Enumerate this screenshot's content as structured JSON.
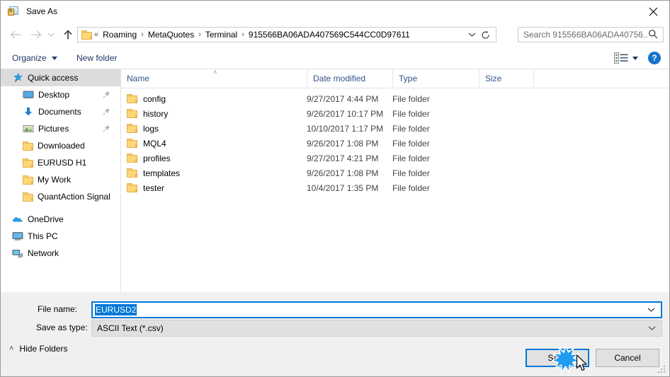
{
  "window": {
    "title": "Save As",
    "title_icon": "save-as-picture-icon",
    "close_label": "✕"
  },
  "nav": {
    "back_icon": "arrow-left-icon",
    "forward_icon": "arrow-right-icon",
    "recent_icon": "chevron-down-icon",
    "up_icon": "arrow-up-icon",
    "breadcrumb_prefix": "«",
    "breadcrumbs": [
      "Roaming",
      "MetaQuotes",
      "Terminal",
      "915566BA06ADA407569C544CC0D97611"
    ],
    "breadcrumb_separator": "›",
    "dropdown_icon": "chevron-down-icon",
    "refresh_icon": "refresh-icon"
  },
  "search": {
    "placeholder": "Search 915566BA06ADA40756...",
    "icon": "search-icon"
  },
  "toolbar": {
    "organize_label": "Organize",
    "new_folder_label": "New folder",
    "view_icon": "view-layout-icon",
    "view_caret_icon": "caret-down-icon",
    "help_label": "?"
  },
  "sidebar": {
    "items": [
      {
        "label": "Quick access",
        "icon": "star-pin-icon",
        "level": 0,
        "selected": true,
        "pinned": false
      },
      {
        "label": "Desktop",
        "icon": "monitor-icon",
        "level": 1,
        "selected": false,
        "pinned": true
      },
      {
        "label": "Documents",
        "icon": "download-arrow-icon",
        "level": 1,
        "selected": false,
        "pinned": true
      },
      {
        "label": "Pictures",
        "icon": "picture-icon",
        "level": 1,
        "selected": false,
        "pinned": true
      },
      {
        "label": "Downloaded",
        "icon": "folder-icon",
        "level": 1,
        "selected": false,
        "pinned": false
      },
      {
        "label": "EURUSD H1",
        "icon": "folder-icon",
        "level": 1,
        "selected": false,
        "pinned": false
      },
      {
        "label": "My Work",
        "icon": "folder-icon",
        "level": 1,
        "selected": false,
        "pinned": false
      },
      {
        "label": "QuantAction Signal",
        "icon": "folder-icon",
        "level": 1,
        "selected": false,
        "pinned": false
      },
      {
        "label": "OneDrive",
        "icon": "onedrive-cloud-icon",
        "level": 0,
        "selected": false,
        "pinned": false
      },
      {
        "label": "This PC",
        "icon": "this-pc-icon",
        "level": 0,
        "selected": false,
        "pinned": false
      },
      {
        "label": "Network",
        "icon": "network-icon",
        "level": 0,
        "selected": false,
        "pinned": false
      }
    ]
  },
  "filelist": {
    "columns": [
      "Name",
      "Date modified",
      "Type",
      "Size"
    ],
    "sort_column": "Name",
    "sort_caret": "˄",
    "rows": [
      {
        "name": "config",
        "date": "9/27/2017 4:44 PM",
        "type": "File folder",
        "size": ""
      },
      {
        "name": "history",
        "date": "9/26/2017 10:17 PM",
        "type": "File folder",
        "size": ""
      },
      {
        "name": "logs",
        "date": "10/10/2017 1:17 PM",
        "type": "File folder",
        "size": ""
      },
      {
        "name": "MQL4",
        "date": "9/26/2017 1:08 PM",
        "type": "File folder",
        "size": ""
      },
      {
        "name": "profiles",
        "date": "9/27/2017 4:21 PM",
        "type": "File folder",
        "size": ""
      },
      {
        "name": "templates",
        "date": "9/26/2017 1:08 PM",
        "type": "File folder",
        "size": ""
      },
      {
        "name": "tester",
        "date": "10/4/2017 1:35 PM",
        "type": "File folder",
        "size": ""
      }
    ]
  },
  "form": {
    "filename_label": "File name:",
    "filename_value": "EURUSD2",
    "savetype_label": "Save as type:",
    "savetype_value": "ASCII Text (*.csv)",
    "hide_folders_label": "Hide Folders",
    "hide_folders_caret": "˄"
  },
  "buttons": {
    "save_label": "Save",
    "cancel_label": "Cancel"
  },
  "colors": {
    "accent": "#0078d7",
    "selection": "#0078d7",
    "folder": "#ffd678",
    "header_text": "#33538a",
    "help_blue": "#1673c6"
  }
}
